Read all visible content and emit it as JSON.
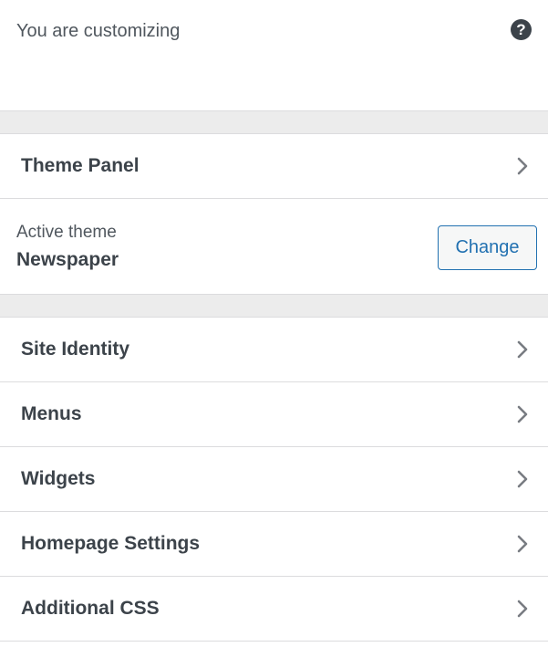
{
  "header": {
    "title": "You are customizing",
    "help_icon": "?"
  },
  "sections": [
    {
      "label": "Theme Panel"
    }
  ],
  "active_theme": {
    "caption": "Active theme",
    "name": "Newspaper",
    "change_label": "Change"
  },
  "menu": [
    {
      "label": "Site Identity"
    },
    {
      "label": "Menus"
    },
    {
      "label": "Widgets"
    },
    {
      "label": "Homepage Settings"
    },
    {
      "label": "Additional CSS"
    }
  ],
  "colors": {
    "accent": "#2271b1",
    "text": "#3c434a",
    "divider": "#dcdcde",
    "gap": "#ececec"
  },
  "icons": {
    "help": "help-circle-icon",
    "chevron": "chevron-right-icon"
  }
}
